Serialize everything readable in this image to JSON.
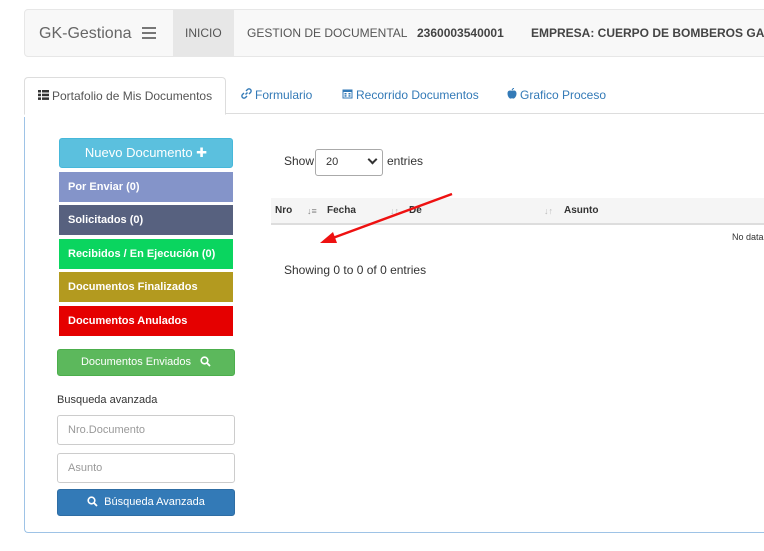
{
  "navbar": {
    "brand": "GK-Gestiona",
    "items": [
      "INICIO",
      "GESTION DE DOCUMENTAL",
      "2360003540001",
      "EMPRESA: CUERPO DE BOMBEROS GAD DE"
    ]
  },
  "tabs": [
    {
      "label": "Portafolio de Mis Documentos",
      "icon": "table-list-icon"
    },
    {
      "label": "Formulario",
      "icon": "link-icon"
    },
    {
      "label": "Recorrido Documentos",
      "icon": "calendar-icon"
    },
    {
      "label": "Grafico Proceso",
      "icon": "apple-icon"
    }
  ],
  "sidebar": {
    "nuevo": "Nuevo Documento",
    "por_enviar": "Por Enviar (0)",
    "solicitados": "Solicitados (0)",
    "recibidos": "Recibidos / En Ejecución (0)",
    "finalizados": "Documentos Finalizados",
    "anulados": "Documentos Anulados",
    "enviados": "Documentos Enviados",
    "busqueda_label": "Busqueda avanzada",
    "nro_placeholder": "Nro.Documento",
    "asunto_placeholder": "Asunto",
    "avanzada": "Búsqueda Avanzada"
  },
  "table": {
    "show_label": "Show",
    "page_size": "20",
    "entries_label": "entries",
    "columns": [
      "Nro",
      "Fecha",
      "De",
      "Asunto"
    ],
    "no_data": "No data",
    "info": "Showing 0 to 0 of 0 entries"
  },
  "colors": {
    "info": "#5bc0de",
    "por_enviar": "#8494c9",
    "solicitados": "#57617f",
    "recibidos": "#0ad55f",
    "finalizados": "#b39a1f",
    "anulados": "#e50000",
    "success": "#5cb85c",
    "primary": "#337ab7",
    "annotation": "#e11"
  }
}
